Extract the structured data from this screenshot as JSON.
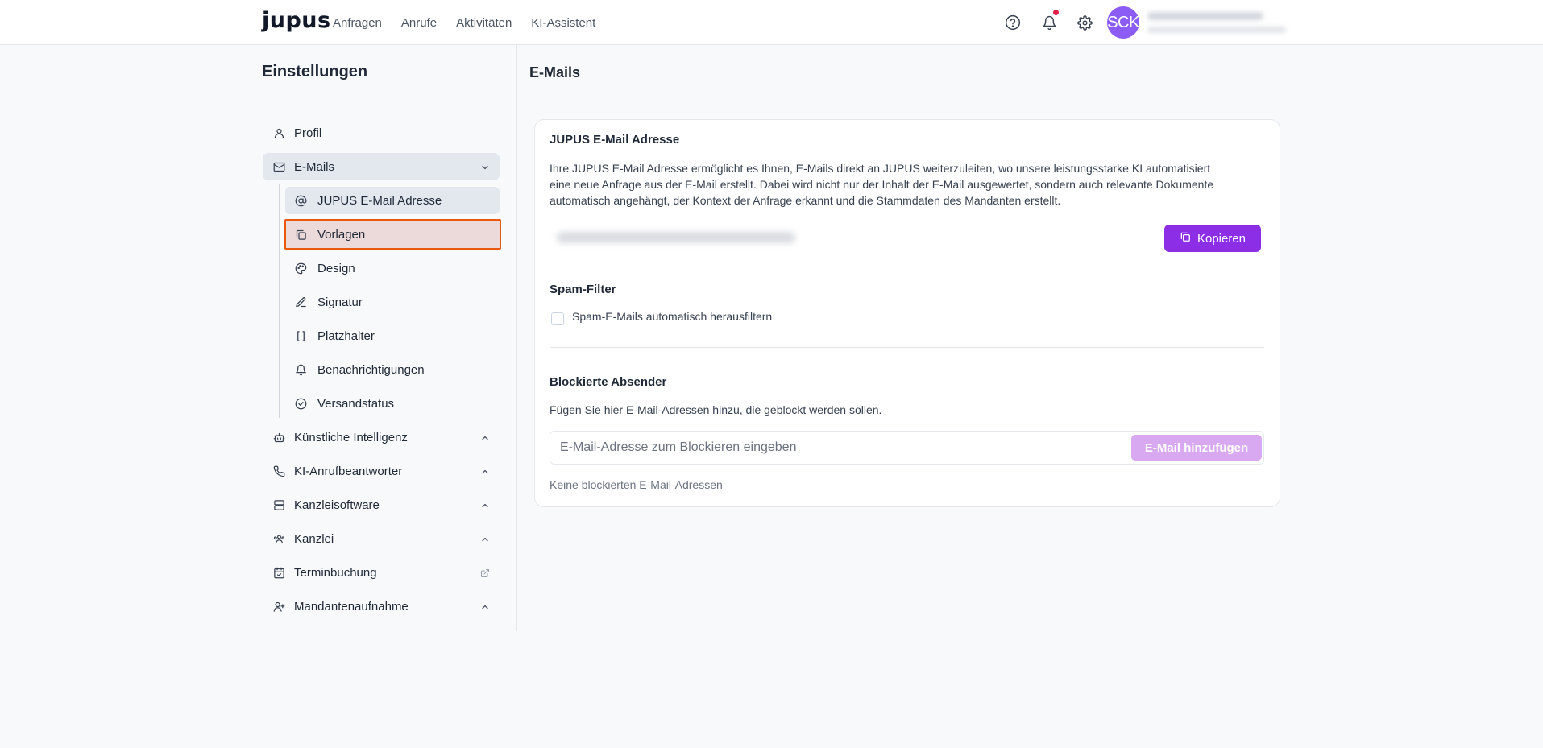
{
  "header": {
    "logo": "jupus",
    "nav": [
      "Anfragen",
      "Anrufe",
      "Aktivitäten",
      "KI-Assistent"
    ],
    "avatar_initials": "SCK"
  },
  "settings": {
    "title": "Einstellungen",
    "sidebar": {
      "profil": "Profil",
      "emails": "E-Mails",
      "sub": {
        "jupus_email": "JUPUS E-Mail Adresse",
        "vorlagen": "Vorlagen",
        "design": "Design",
        "signatur": "Signatur",
        "platzhalter": "Platzhalter",
        "benachrichtigungen": "Benachrichtigungen",
        "versandstatus": "Versandstatus"
      },
      "ki": "Künstliche Intelligenz",
      "ki_anruf": "KI-Anrufbeantworter",
      "kanzleisoftware": "Kanzleisoftware",
      "kanzlei": "Kanzlei",
      "terminbuchung": "Terminbuchung",
      "mandantenaufnahme": "Mandantenaufnahme"
    }
  },
  "main": {
    "title": "E-Mails",
    "jupus_email": {
      "heading": "JUPUS E-Mail Adresse",
      "description_lines": [
        "Ihre JUPUS E-Mail Adresse ermöglicht es Ihnen, E-Mails direkt an JUPUS weiterzuleiten, wo unsere leistungsstarke KI automatisiert",
        "eine neue Anfrage aus der E-Mail erstellt. Dabei wird nicht nur der Inhalt der E-Mail ausgewertet, sondern auch relevante Dokumente",
        "automatisch angehängt, der Kontext der Anfrage erkannt und die Stammdaten des Mandanten erstellt."
      ],
      "copy_button": "Kopieren"
    },
    "spam": {
      "heading": "Spam-Filter",
      "checkbox_label": "Spam-E-Mails automatisch herausfiltern",
      "checked": false
    },
    "blocked": {
      "heading": "Blockierte Absender",
      "description": "Fügen Sie hier E-Mail-Adressen hinzu, die geblockt werden sollen.",
      "input_placeholder": "E-Mail-Adresse zum Blockieren eingeben",
      "input_value": "",
      "add_button": "E-Mail hinzufügen",
      "empty_text": "Keine blockierten E-Mail-Adressen"
    }
  },
  "colors": {
    "accent": "#8b2ee6",
    "accent_disabled": "#d8a8f0",
    "avatar": "#8b5cf6",
    "highlight_border": "#ea580c",
    "notification_dot": "#e11d48"
  }
}
